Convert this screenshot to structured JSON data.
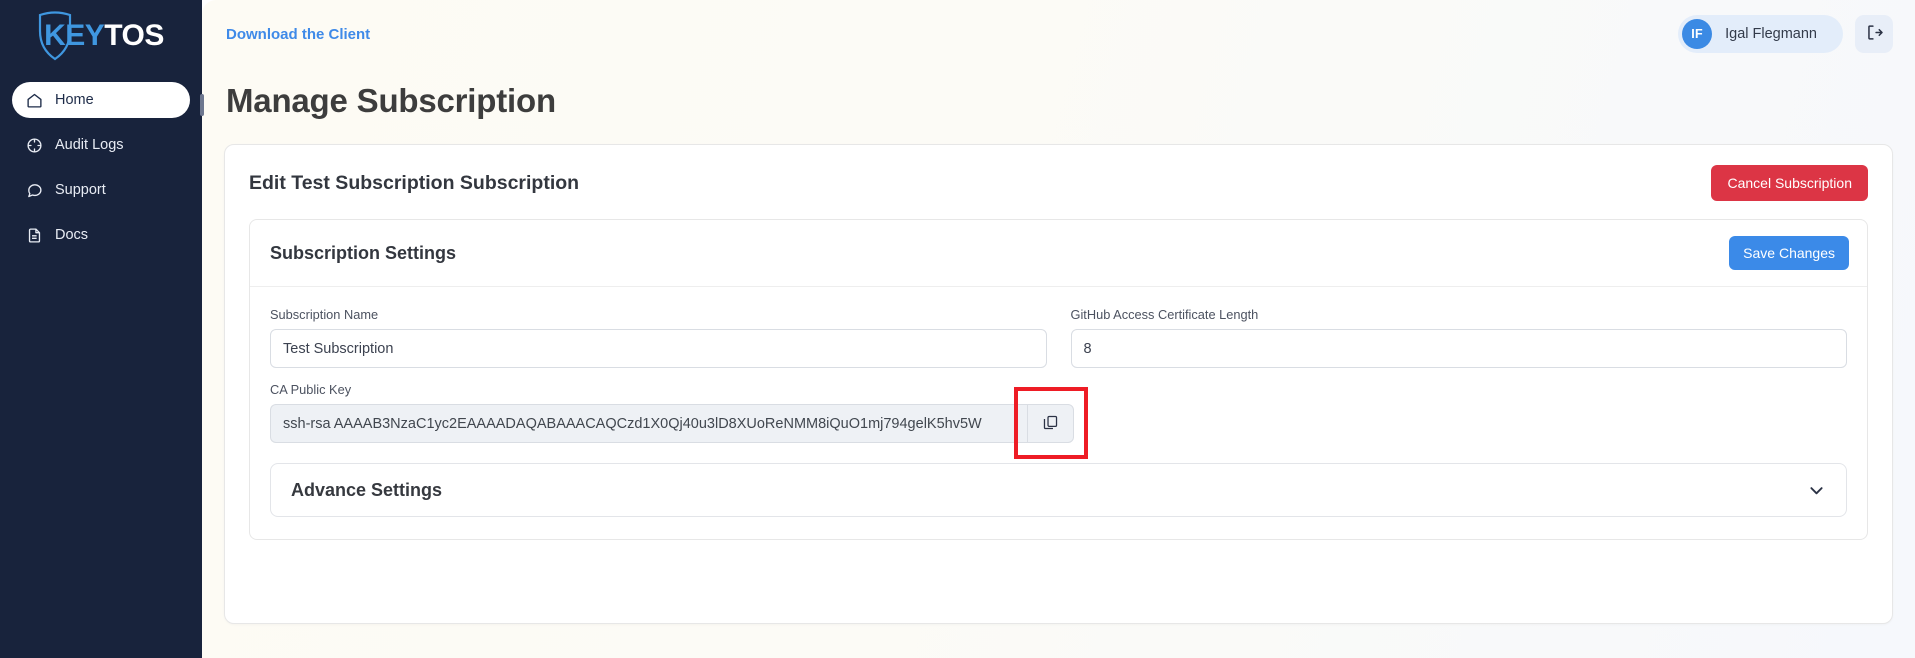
{
  "sidebar": {
    "logo": {
      "part1": "KEY",
      "part2": "TOS",
      "icon": "shield-icon"
    },
    "items": [
      {
        "label": "Home",
        "icon": "home-icon",
        "active": true
      },
      {
        "label": "Audit Logs",
        "icon": "clock-icon",
        "active": false
      },
      {
        "label": "Support",
        "icon": "chat-icon",
        "active": false
      },
      {
        "label": "Docs",
        "icon": "document-icon",
        "active": false
      }
    ],
    "background_color": "#18233c"
  },
  "topbar": {
    "download_link": "Download the Client",
    "user": {
      "initials": "IF",
      "name": "Igal Flegmann",
      "avatar_color": "#3b8ae4"
    },
    "logout_icon": "logout-icon"
  },
  "page": {
    "title": "Manage Subscription"
  },
  "subscription_card": {
    "title": "Edit Test Subscription Subscription",
    "cancel_button": "Cancel Subscription",
    "cancel_button_color": "#dc3545"
  },
  "settings_card": {
    "title": "Subscription Settings",
    "save_button": "Save Changes",
    "save_button_color": "#3b8ae8",
    "fields": {
      "subscription_name": {
        "label": "Subscription Name",
        "value": "Test Subscription"
      },
      "github_cert_length": {
        "label": "GitHub Access Certificate Length",
        "value": "8"
      },
      "ca_public_key": {
        "label": "CA Public Key",
        "value": "ssh-rsa AAAAB3NzaC1yc2EAAAADAQABAAACAQCzd1X0Qj40u3lD8XUoReNMM8iQuO1mj794gelK5hv5W",
        "copy_icon": "copy-icon"
      }
    },
    "advance_settings": {
      "label": "Advance Settings",
      "chevron_icon": "chevron-down-icon"
    }
  },
  "highlight": {
    "color": "#ee1c25",
    "target": "copy-icon"
  }
}
